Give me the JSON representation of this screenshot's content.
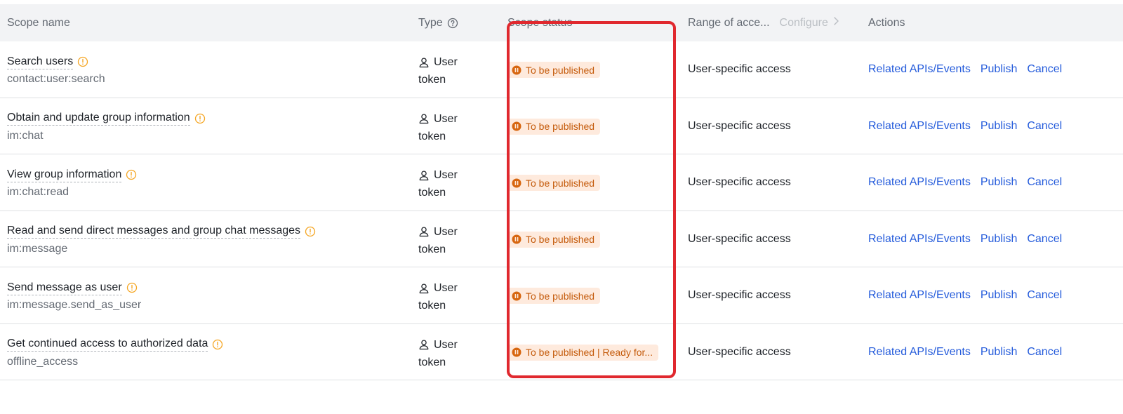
{
  "header": {
    "scope_name": "Scope name",
    "type": "Type",
    "scope_status": "Scope status",
    "range": "Range of acce...",
    "configure": "Configure",
    "actions": "Actions"
  },
  "rows": [
    {
      "title": "Search users",
      "code": "contact:user:search",
      "type_line1": "User",
      "type_line2": "token",
      "status": "To be published",
      "range": "User-specific access",
      "actions": [
        "Related APIs/Events",
        "Publish",
        "Cancel"
      ]
    },
    {
      "title": "Obtain and update group information",
      "code": "im:chat",
      "type_line1": "User",
      "type_line2": "token",
      "status": "To be published",
      "range": "User-specific access",
      "actions": [
        "Related APIs/Events",
        "Publish",
        "Cancel"
      ]
    },
    {
      "title": "View group information",
      "code": "im:chat:read",
      "type_line1": "User",
      "type_line2": "token",
      "status": "To be published",
      "range": "User-specific access",
      "actions": [
        "Related APIs/Events",
        "Publish",
        "Cancel"
      ]
    },
    {
      "title": "Read and send direct messages and group chat messages",
      "code": "im:message",
      "type_line1": "User",
      "type_line2": "token",
      "status": "To be published",
      "range": "User-specific access",
      "actions": [
        "Related APIs/Events",
        "Publish",
        "Cancel"
      ]
    },
    {
      "title": "Send message as user",
      "code": "im:message.send_as_user",
      "type_line1": "User",
      "type_line2": "token",
      "status": "To be published",
      "range": "User-specific access",
      "actions": [
        "Related APIs/Events",
        "Publish",
        "Cancel"
      ]
    },
    {
      "title": "Get continued access to authorized data",
      "code": "offline_access",
      "type_line1": "User",
      "type_line2": "token",
      "status": "To be published | Ready for...",
      "range": "User-specific access",
      "actions": [
        "Related APIs/Events",
        "Publish",
        "Cancel"
      ]
    }
  ],
  "colors": {
    "header_bg": "#f2f3f5",
    "link": "#245bdb",
    "badge_bg": "#feeadd",
    "badge_text": "#c45a0a",
    "warning": "#f5a623",
    "highlight_border": "#e0282e"
  },
  "icons": {
    "type_help": "question-circle-icon",
    "scope_warning": "warning-circle-icon",
    "type_user": "user-icon",
    "status": "pause-circle-icon",
    "configure": "chevron-right-icon"
  }
}
